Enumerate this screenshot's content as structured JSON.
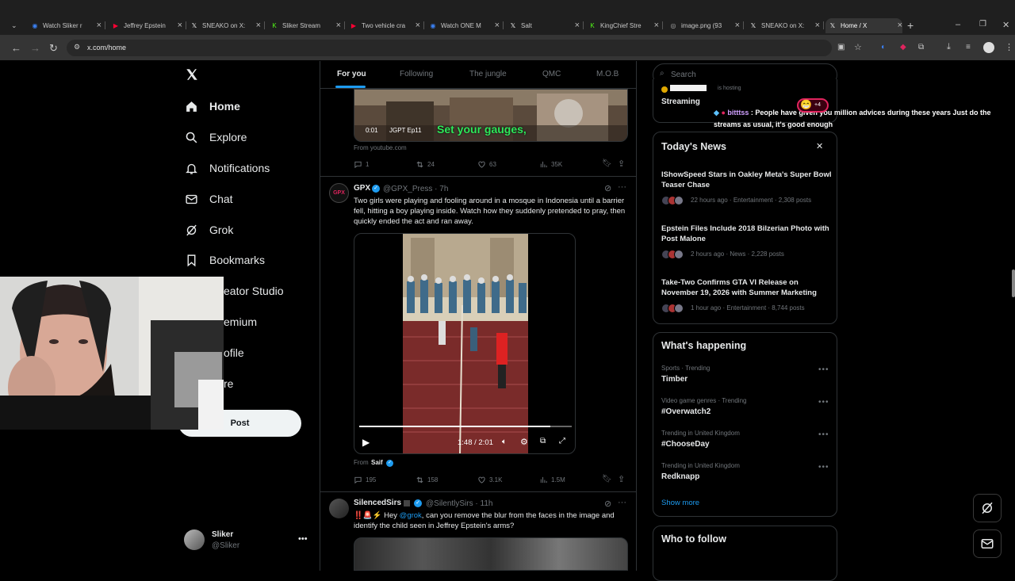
{
  "browser": {
    "tabs": [
      {
        "title": "Watch Sliker r",
        "icon": "kick-like-icon",
        "color": "#3b82f6"
      },
      {
        "title": "Jeffrey Epstein",
        "icon": "youtube-icon",
        "color": "#ff0033"
      },
      {
        "title": "SNEAKO on X:",
        "icon": "x-icon",
        "color": "#ffffff"
      },
      {
        "title": "Sliker Stream",
        "icon": "kick-icon",
        "color": "#53fc18"
      },
      {
        "title": "Two vehicle cra",
        "icon": "youtube-icon",
        "color": "#ff0033"
      },
      {
        "title": "Watch ONE M",
        "icon": "kick-like-icon",
        "color": "#3b82f6"
      },
      {
        "title": "Salt",
        "icon": "x-icon",
        "color": "#ffffff"
      },
      {
        "title": "KingChief Stre",
        "icon": "kick-icon",
        "color": "#53fc18"
      },
      {
        "title": "image.png (93",
        "icon": "globe-icon",
        "color": "#aaaaaa"
      },
      {
        "title": "SNEAKO on X:",
        "icon": "x-icon",
        "color": "#ffffff"
      },
      {
        "title": "Home / X",
        "icon": "x-icon",
        "color": "#ffffff"
      }
    ],
    "url": "x.com/home"
  },
  "sidebar": {
    "items": [
      {
        "label": "Home",
        "icon": "home-icon"
      },
      {
        "label": "Explore",
        "icon": "search-icon"
      },
      {
        "label": "Notifications",
        "icon": "bell-icon"
      },
      {
        "label": "Chat",
        "icon": "mail-icon"
      },
      {
        "label": "Grok",
        "icon": "grok-icon"
      },
      {
        "label": "Bookmarks",
        "icon": "bookmark-icon"
      },
      {
        "label": "eator Studio",
        "icon": ""
      },
      {
        "label": "emium",
        "icon": ""
      },
      {
        "label": "ofile",
        "icon": ""
      },
      {
        "label": "re",
        "icon": ""
      }
    ],
    "post_label": "Post",
    "account": {
      "name": "Sliker",
      "handle": "@Sliker"
    }
  },
  "feed": {
    "tabs": [
      "For you",
      "Following",
      "The jungle",
      "QMC",
      "M.O.B"
    ],
    "post0": {
      "video_time": "0:01",
      "video_tag": "JGPT Ep11",
      "caption": "Set your gauges,",
      "source": "From youtube.com",
      "replies": "1",
      "reposts": "24",
      "likes": "63",
      "views": "35K"
    },
    "post1": {
      "name": "GPX",
      "handle": "@GPX_Press · 7h",
      "avatar": "GPX",
      "text": "Two girls were playing and fooling around in a mosque in Indonesia until a barrier fell, hitting a boy playing inside. Watch how they suddenly pretended to pray, then quickly ended the act and ran away.",
      "video_time": "1:48 / 2:01",
      "from_label": "From",
      "from_name": "Saif",
      "progress": 0.9,
      "replies": "195",
      "reposts": "158",
      "likes": "3.1K",
      "views": "1.5M"
    },
    "post2": {
      "name": "SilencedSirs",
      "handle": "@SilentlySirs · 11h",
      "text_a": "‼️🚨⚡ Hey ",
      "mention": "@grok",
      "text_b": ", can you remove the blur from the faces in the image and identify the child seen in Jeffrey Epstein's arms?"
    }
  },
  "right": {
    "search_placeholder": "Search",
    "live": {
      "host": "is hosting",
      "label": "Streaming"
    },
    "chat_overlay": {
      "user": "bitttss",
      "message": " : People have given you million advices during these years  Just do the streams as usual, it's good enough",
      "badge": "+4"
    },
    "news_title": "Today's News",
    "news": [
      {
        "title": "IShowSpeed Stars in Oakley Meta's Super Bowl Teaser Chase",
        "meta": "22 hours ago · Entertainment · 2,308 posts"
      },
      {
        "title": "Epstein Files Include 2018 Bilzerian Photo with Post Malone",
        "meta": "2 hours ago · News · 2,228 posts"
      },
      {
        "title": "Take-Two Confirms GTA VI Release on November 19, 2026 with Summer Marketing",
        "meta": "1 hour ago · Entertainment · 8,744 posts"
      }
    ],
    "happening_title": "What's happening",
    "trends": [
      {
        "meta": "Sports · Trending",
        "name": "Timber"
      },
      {
        "meta": "Video game genres · Trending",
        "name": "#Overwatch2"
      },
      {
        "meta": "Trending in United Kingdom",
        "name": "#ChooseDay"
      },
      {
        "meta": "Trending in United Kingdom",
        "name": "Redknapp"
      }
    ],
    "show_more": "Show more",
    "follow_title": "Who to follow"
  },
  "colors": {
    "accent": "#1d9bf0",
    "verified": "#1d9bf0"
  }
}
